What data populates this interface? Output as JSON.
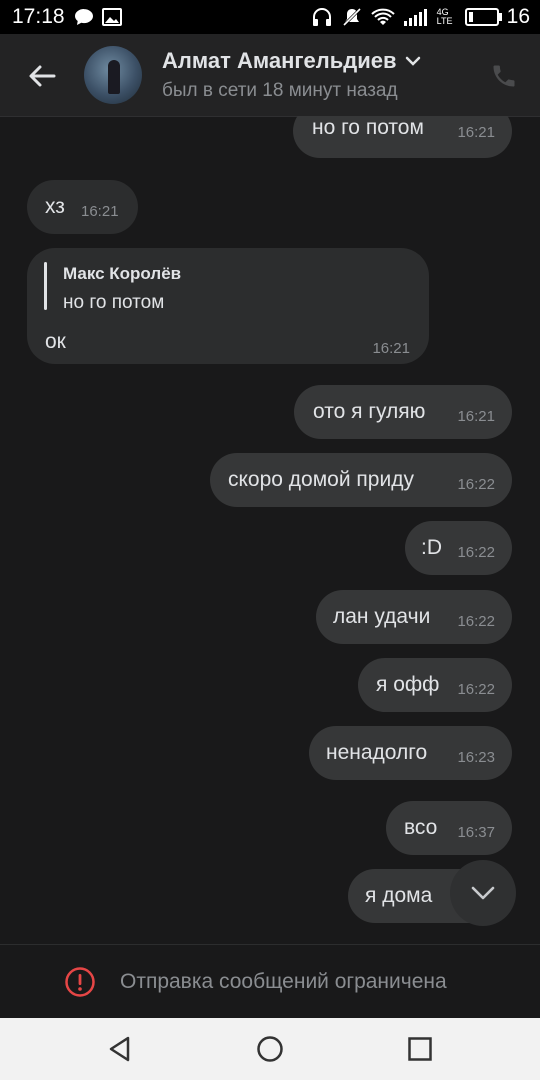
{
  "status_bar": {
    "time": "17:18",
    "network": "4G LTE",
    "battery": "16"
  },
  "header": {
    "name": "Алмат Амангельдиев",
    "status": "был в сети 18 минут назад"
  },
  "messages": [
    {
      "text": "но го потом",
      "time": "16:21",
      "dir": "out"
    },
    {
      "text": "хз",
      "time": "16:21",
      "dir": "in"
    },
    {
      "reply_author": "Макс Королёв",
      "reply_text": "но го потом",
      "text": "ок",
      "time": "16:21",
      "dir": "in"
    },
    {
      "text": "ото я гуляю",
      "time": "16:21",
      "dir": "out"
    },
    {
      "text": "скоро домой приду",
      "time": "16:22",
      "dir": "out"
    },
    {
      "text": ":D",
      "time": "16:22",
      "dir": "out"
    },
    {
      "text": "лан удачи",
      "time": "16:22",
      "dir": "out"
    },
    {
      "text": "я офф",
      "time": "16:22",
      "dir": "out"
    },
    {
      "text": "ненадолго",
      "time": "16:23",
      "dir": "out"
    },
    {
      "text": "всо",
      "time": "16:37",
      "dir": "out"
    },
    {
      "text": "я дома",
      "time": "",
      "dir": "out"
    }
  ],
  "footer": {
    "restriction_text": "Отправка сообщений ограничена"
  },
  "colors": {
    "background": "#19191a",
    "bubble": "#363738",
    "alert": "#e64646"
  }
}
